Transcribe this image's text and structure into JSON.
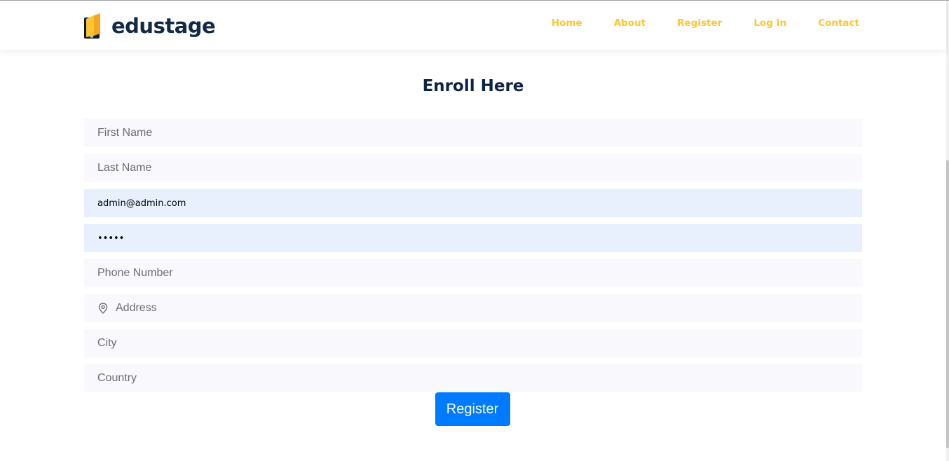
{
  "brand": {
    "name": "edustage",
    "logo_icon": "book-icon",
    "logo_color": "#fdc632"
  },
  "nav": {
    "items": [
      {
        "label": "Home"
      },
      {
        "label": "About"
      },
      {
        "label": "Register"
      },
      {
        "label": "Log In"
      },
      {
        "label": "Contact"
      }
    ],
    "link_color": "#fdc632"
  },
  "main": {
    "title": "Enroll Here"
  },
  "form": {
    "first_name": {
      "placeholder": "First Name",
      "value": ""
    },
    "last_name": {
      "placeholder": "Last Name",
      "value": ""
    },
    "email": {
      "placeholder": "",
      "value": "admin@admin.com"
    },
    "password": {
      "placeholder": "",
      "value": "•••••"
    },
    "phone": {
      "placeholder": "Phone Number",
      "value": ""
    },
    "address": {
      "placeholder": "Address",
      "value": "",
      "icon": "map-pin-icon"
    },
    "city": {
      "placeholder": "City",
      "value": ""
    },
    "country": {
      "placeholder": "Country",
      "value": ""
    },
    "submit_label": "Register"
  },
  "colors": {
    "accent": "#fdc632",
    "heading": "#0f2445",
    "button": "#007bff",
    "field_bg": "#f8f8fd",
    "autofill_bg": "#e8f0fe"
  }
}
